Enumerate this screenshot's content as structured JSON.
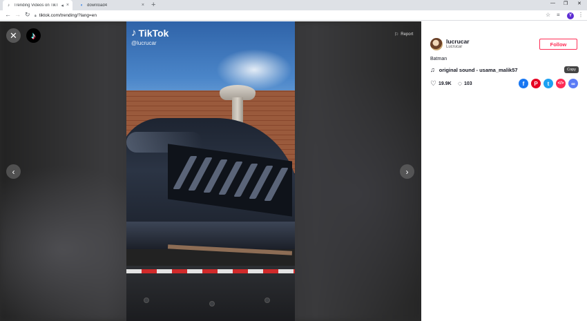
{
  "browser": {
    "tabs": [
      {
        "title": "Trending Videos on TikTok",
        "active": true
      },
      {
        "title": "download4",
        "active": false
      }
    ],
    "url": "tiktok.com/trending/?lang=en",
    "profile_initial": "Y"
  },
  "video": {
    "watermark_brand": "TikTok",
    "watermark_handle": "@lucrucar",
    "report_label": "Report"
  },
  "panel": {
    "username": "lucrucar",
    "nickname": "Lucrucar",
    "follow_label": "Follow",
    "caption": "Batman",
    "sound": "original sound - usama_malik57",
    "likes": "19.9K",
    "comments": "103",
    "tooltip": "Copy"
  },
  "colors": {
    "accent": "#fe2c55",
    "facebook": "#1877f2",
    "pinterest": "#e60023",
    "twitter": "#1da1f2",
    "embed": "#fe2c55",
    "copy": "#5b7cf6"
  }
}
